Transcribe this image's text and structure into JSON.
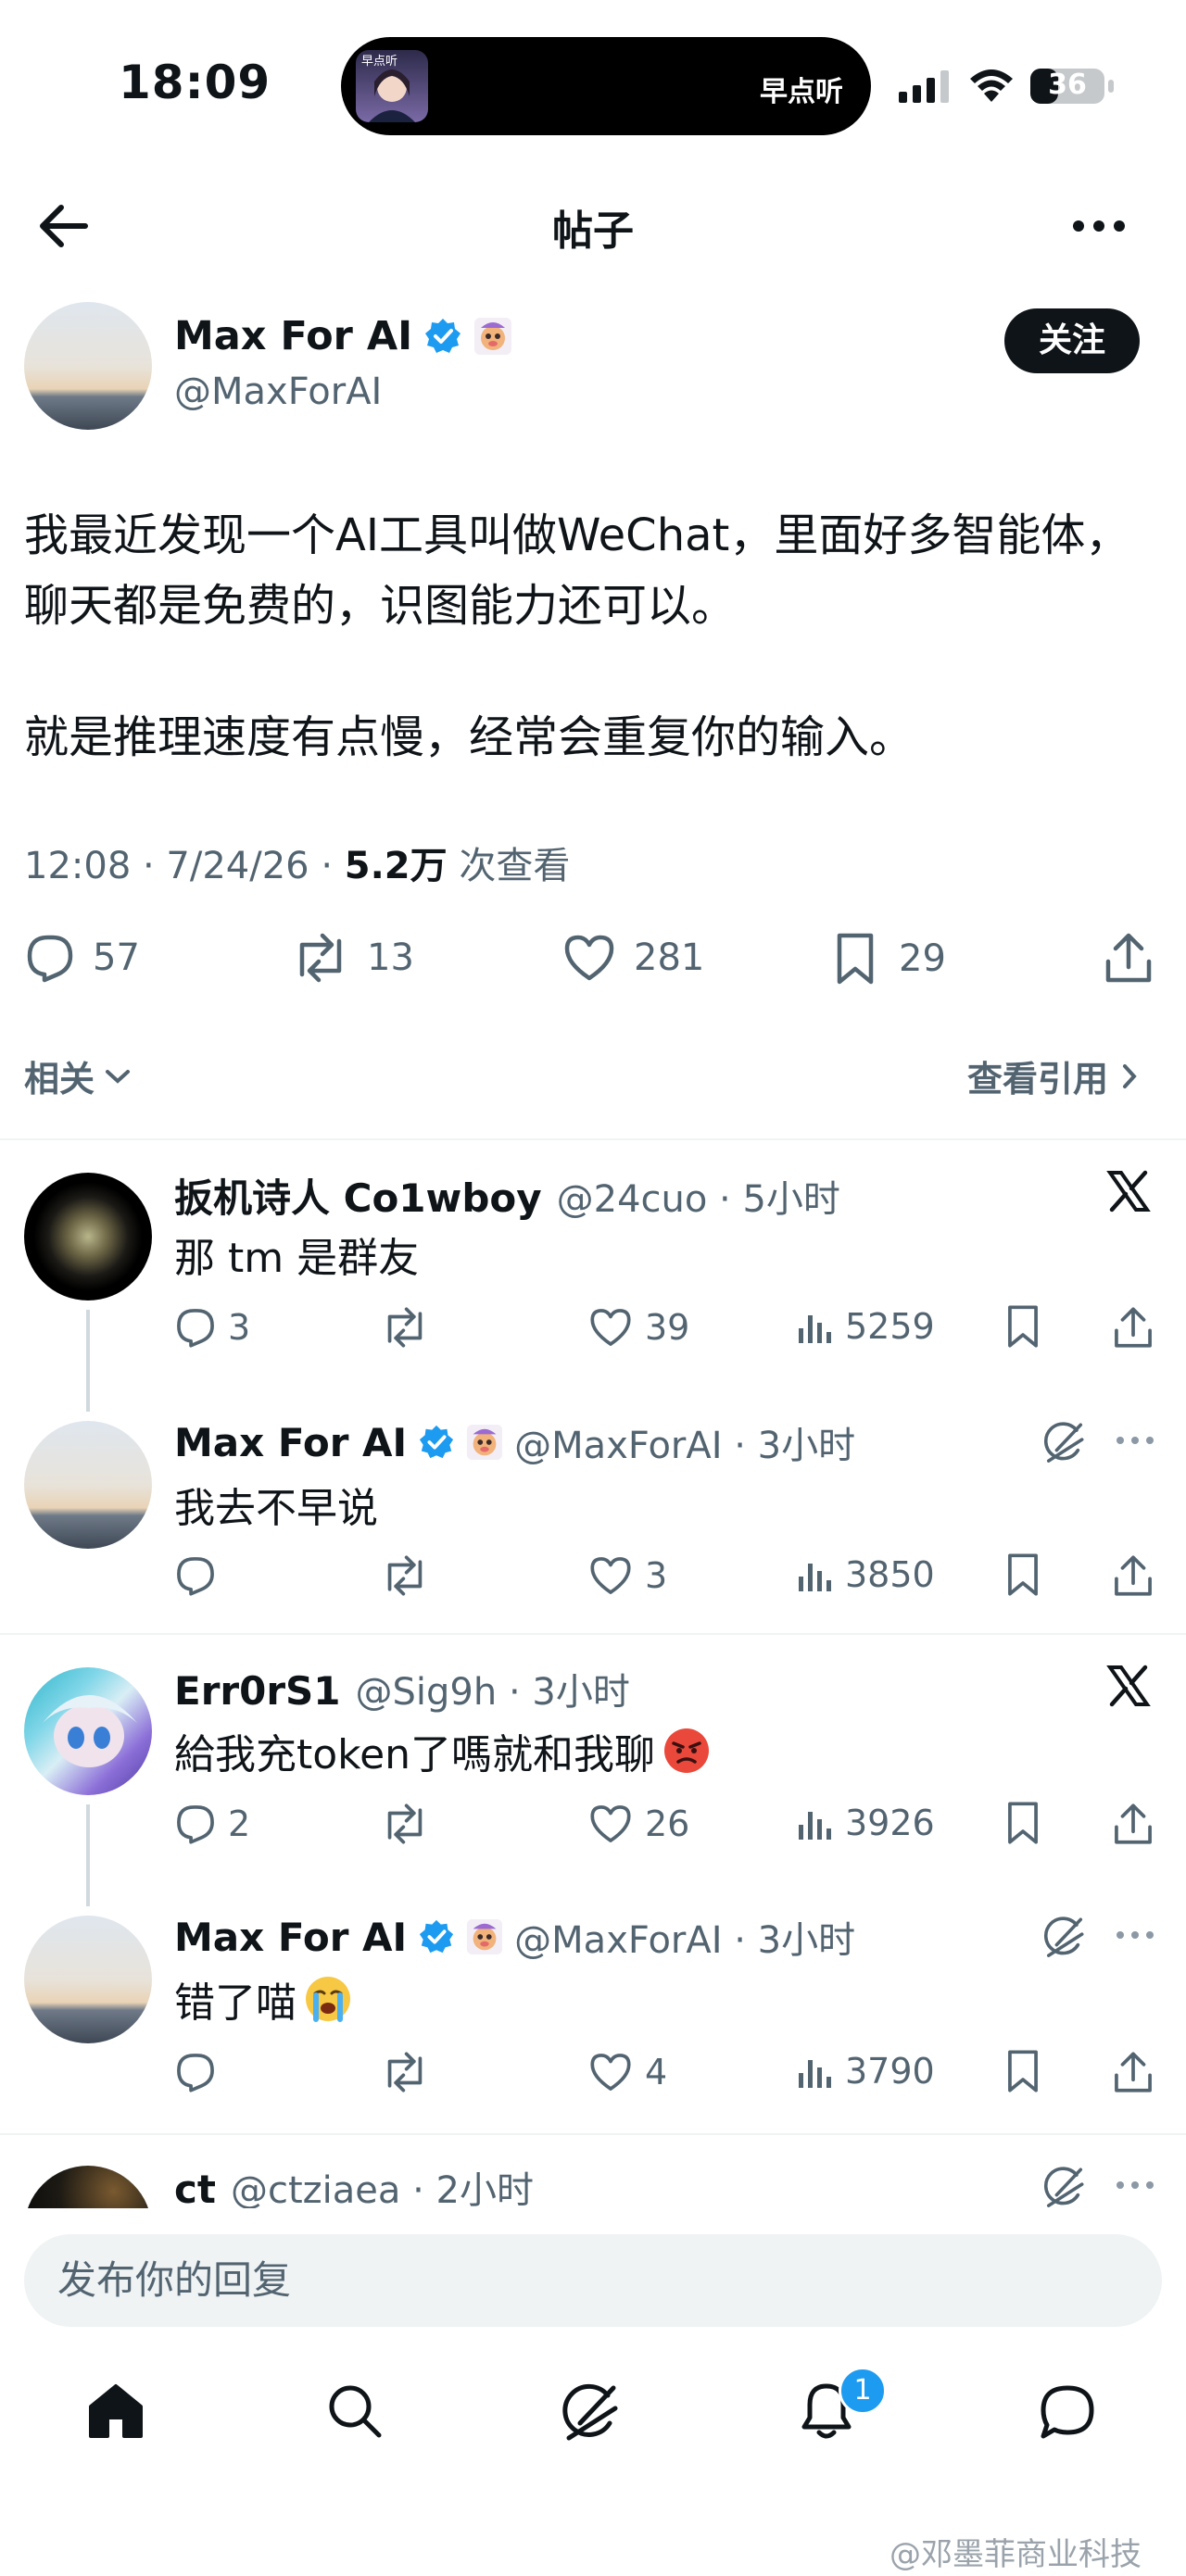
{
  "status_bar": {
    "time": "18:09",
    "island_label": "早点听",
    "battery": "36"
  },
  "header": {
    "title": "帖子"
  },
  "post": {
    "author_name": "Max For AI",
    "author_handle": "@MaxForAI",
    "follow_label": "关注",
    "paragraphs": [
      "我最近发现一个AI工具叫做WeChat，里面好多智能体，聊天都是免费的，识图能力还可以。",
      "就是推理速度有点慢，经常会重复你的输入。"
    ],
    "timestamp": "12:08 · 7/24/26 · ",
    "views_value": "5.2万",
    "views_label": " 次查看",
    "stats": {
      "replies": "57",
      "reposts": "13",
      "likes": "281",
      "bookmarks": "29"
    },
    "related_label": "相关",
    "quotes_label": "查看引用"
  },
  "replies": [
    {
      "name": "扳机诗人 Co1wboy",
      "meta": "@24cuo · 5小时",
      "text": "那 tm 是群友",
      "replies": "3",
      "reposts": "",
      "likes": "39",
      "views": "5259"
    },
    {
      "name": "Max For AI",
      "meta": "@MaxForAI · 3小时",
      "text": "我去不早说",
      "replies": "",
      "reposts": "",
      "likes": "3",
      "views": "3850"
    },
    {
      "name": "Err0rS1",
      "meta": "@Sig9h · 3小时",
      "text": "給我充token了嗎就和我聊",
      "replies": "2",
      "reposts": "",
      "likes": "26",
      "views": "3926"
    },
    {
      "name": "Max For AI",
      "meta": "@MaxForAI · 3小时",
      "text": "错了喵",
      "replies": "",
      "reposts": "",
      "likes": "4",
      "views": "3790"
    },
    {
      "name": "ct",
      "meta": "@ctziaea · 2小时"
    }
  ],
  "composer": {
    "placeholder": "发布你的回复"
  },
  "tab_bar": {
    "notification_count": "1"
  },
  "watermark": "@邓墨菲商业科技",
  "colors": {
    "accent": "#1d9bf0",
    "text": "#0f1419",
    "muted": "#536471",
    "divider": "#eff3f4"
  },
  "icons": [
    "back-arrow-icon",
    "more-icon",
    "verified-icon",
    "emoji-badge-icon",
    "reply-icon",
    "repost-icon",
    "like-icon",
    "bookmark-icon",
    "share-icon",
    "views-icon",
    "x-logo-icon",
    "grok-icon",
    "home-icon",
    "search-icon",
    "notifications-icon",
    "messages-icon"
  ]
}
